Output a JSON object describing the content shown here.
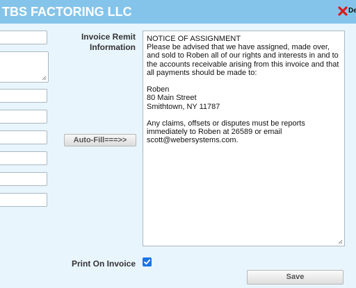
{
  "header": {
    "title": "TBS FACTORING LLC",
    "delete_label": "De",
    "bg_color": "#85c4ea"
  },
  "left_fields": {
    "field1": "",
    "notes": "",
    "field2": "",
    "field3": "",
    "field4": "",
    "field5": "",
    "field6": "",
    "field7": ""
  },
  "remit": {
    "label_line1": "Invoice Remit",
    "label_line2": "Information",
    "text": "NOTICE OF ASSIGNMENT\nPlease be advised that we have assigned, made over,\nand sold to Roben all of our rights and interests in and to\nthe accounts receivable arising from this invoice and that\nall payments should be made to:\n\nRoben\n80 Main Street\nSmithtown, NY 11787\n\nAny claims, offsets or disputes must be reports\nimmediately to Roben at 26589 or email\nscott@webersystems.com."
  },
  "buttons": {
    "autofill_label": "Auto-Fill===>>",
    "save_label": "Save"
  },
  "print_on_invoice": {
    "label": "Print On Invoice",
    "checked": true,
    "checkbox_color": "#1a73e8"
  },
  "icons": {
    "delete": "red-x-icon",
    "checkbox": "checkmark-icon"
  }
}
